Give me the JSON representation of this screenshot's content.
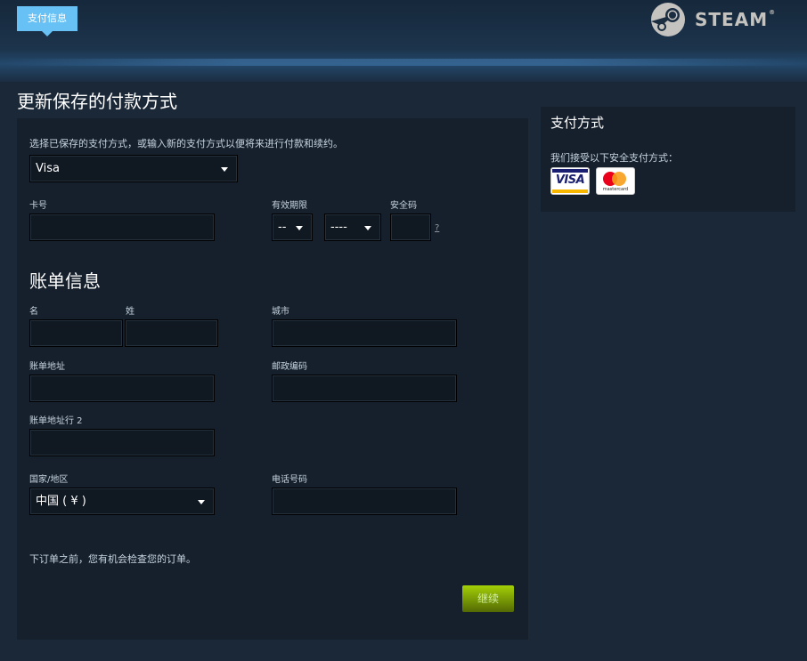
{
  "header": {
    "breadcrumb": "支付信息",
    "logo_text": "STEAM",
    "logo_tm": "®"
  },
  "page_title": "更新保存的付款方式",
  "form": {
    "intro": "选择已保存的支付方式，或输入新的支付方式以便将来进行付款和续约。",
    "payment_method": {
      "selected": "Visa"
    },
    "card_number": {
      "label": "卡号",
      "value": ""
    },
    "expiration": {
      "label": "有效期限",
      "month": "--",
      "year": "----"
    },
    "security_code": {
      "label": "安全码",
      "help": "?"
    },
    "billing_title": "账单信息",
    "first_name": {
      "label": "名",
      "value": ""
    },
    "last_name": {
      "label": "姓",
      "value": ""
    },
    "city": {
      "label": "城市",
      "value": ""
    },
    "billing_address": {
      "label": "账单地址",
      "value": ""
    },
    "postal_code": {
      "label": "邮政编码",
      "value": ""
    },
    "billing_address2": {
      "label": "账单地址行 2",
      "value": ""
    },
    "country": {
      "label": "国家/地区",
      "selected": "中国 ( ¥ )"
    },
    "phone": {
      "label": "电话号码",
      "value": ""
    },
    "review_note": "下订单之前，您有机会检查您的订单。",
    "continue_label": "继续"
  },
  "sidebar": {
    "title": "支付方式",
    "accepted_text": "我们接受以下安全支付方式：",
    "cards": [
      "VISA",
      "mastercard"
    ]
  },
  "colors": {
    "background": "#1b2838",
    "panel": "#16202d",
    "accent_blue": "#67c1f5",
    "button_green": "#a4d007"
  }
}
